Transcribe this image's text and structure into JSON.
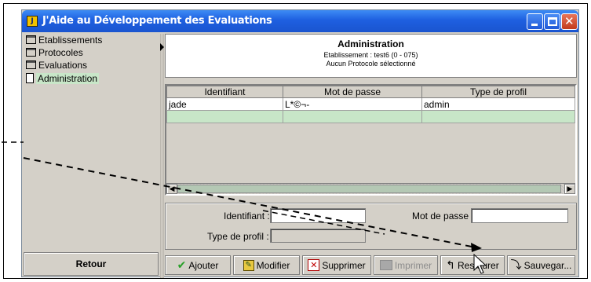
{
  "window": {
    "title": "J'Aide au Développement des Evaluations",
    "app_icon": "J"
  },
  "sidebar": {
    "items": [
      {
        "label": "Etablissements",
        "icon": "folder-icon"
      },
      {
        "label": "Protocoles",
        "icon": "folder-icon"
      },
      {
        "label": "Evaluations",
        "icon": "folder-icon"
      },
      {
        "label": "Administration",
        "icon": "document-icon",
        "selected": true
      }
    ],
    "back_label": "Retour"
  },
  "header": {
    "title": "Administration",
    "establishment": "Etablissement : test6 (0 - 075)",
    "protocol": "Aucun Protocole sélectionné"
  },
  "table": {
    "columns": [
      "Identifiant",
      "Mot de passe",
      "Type de profil"
    ],
    "rows": [
      [
        "jade",
        "L*©¬-",
        "admin"
      ],
      [
        "",
        "",
        ""
      ]
    ]
  },
  "form": {
    "identifiant_label": "Identifiant :",
    "identifiant_value": "",
    "password_label": "Mot de passe :",
    "password_value": "",
    "profile_label": "Type de profil :",
    "profile_value": ""
  },
  "toolbar": {
    "add_label": "Ajouter",
    "modify_label": "Modifier",
    "delete_label": "Supprimer",
    "print_label": "Imprimer",
    "restore_label": "Restaurer",
    "save_label": "Sauvegar..."
  },
  "colors": {
    "titlebar": "#1e5fe0",
    "selection_green": "#c8e6c8",
    "window_face": "#d4d0c8"
  }
}
